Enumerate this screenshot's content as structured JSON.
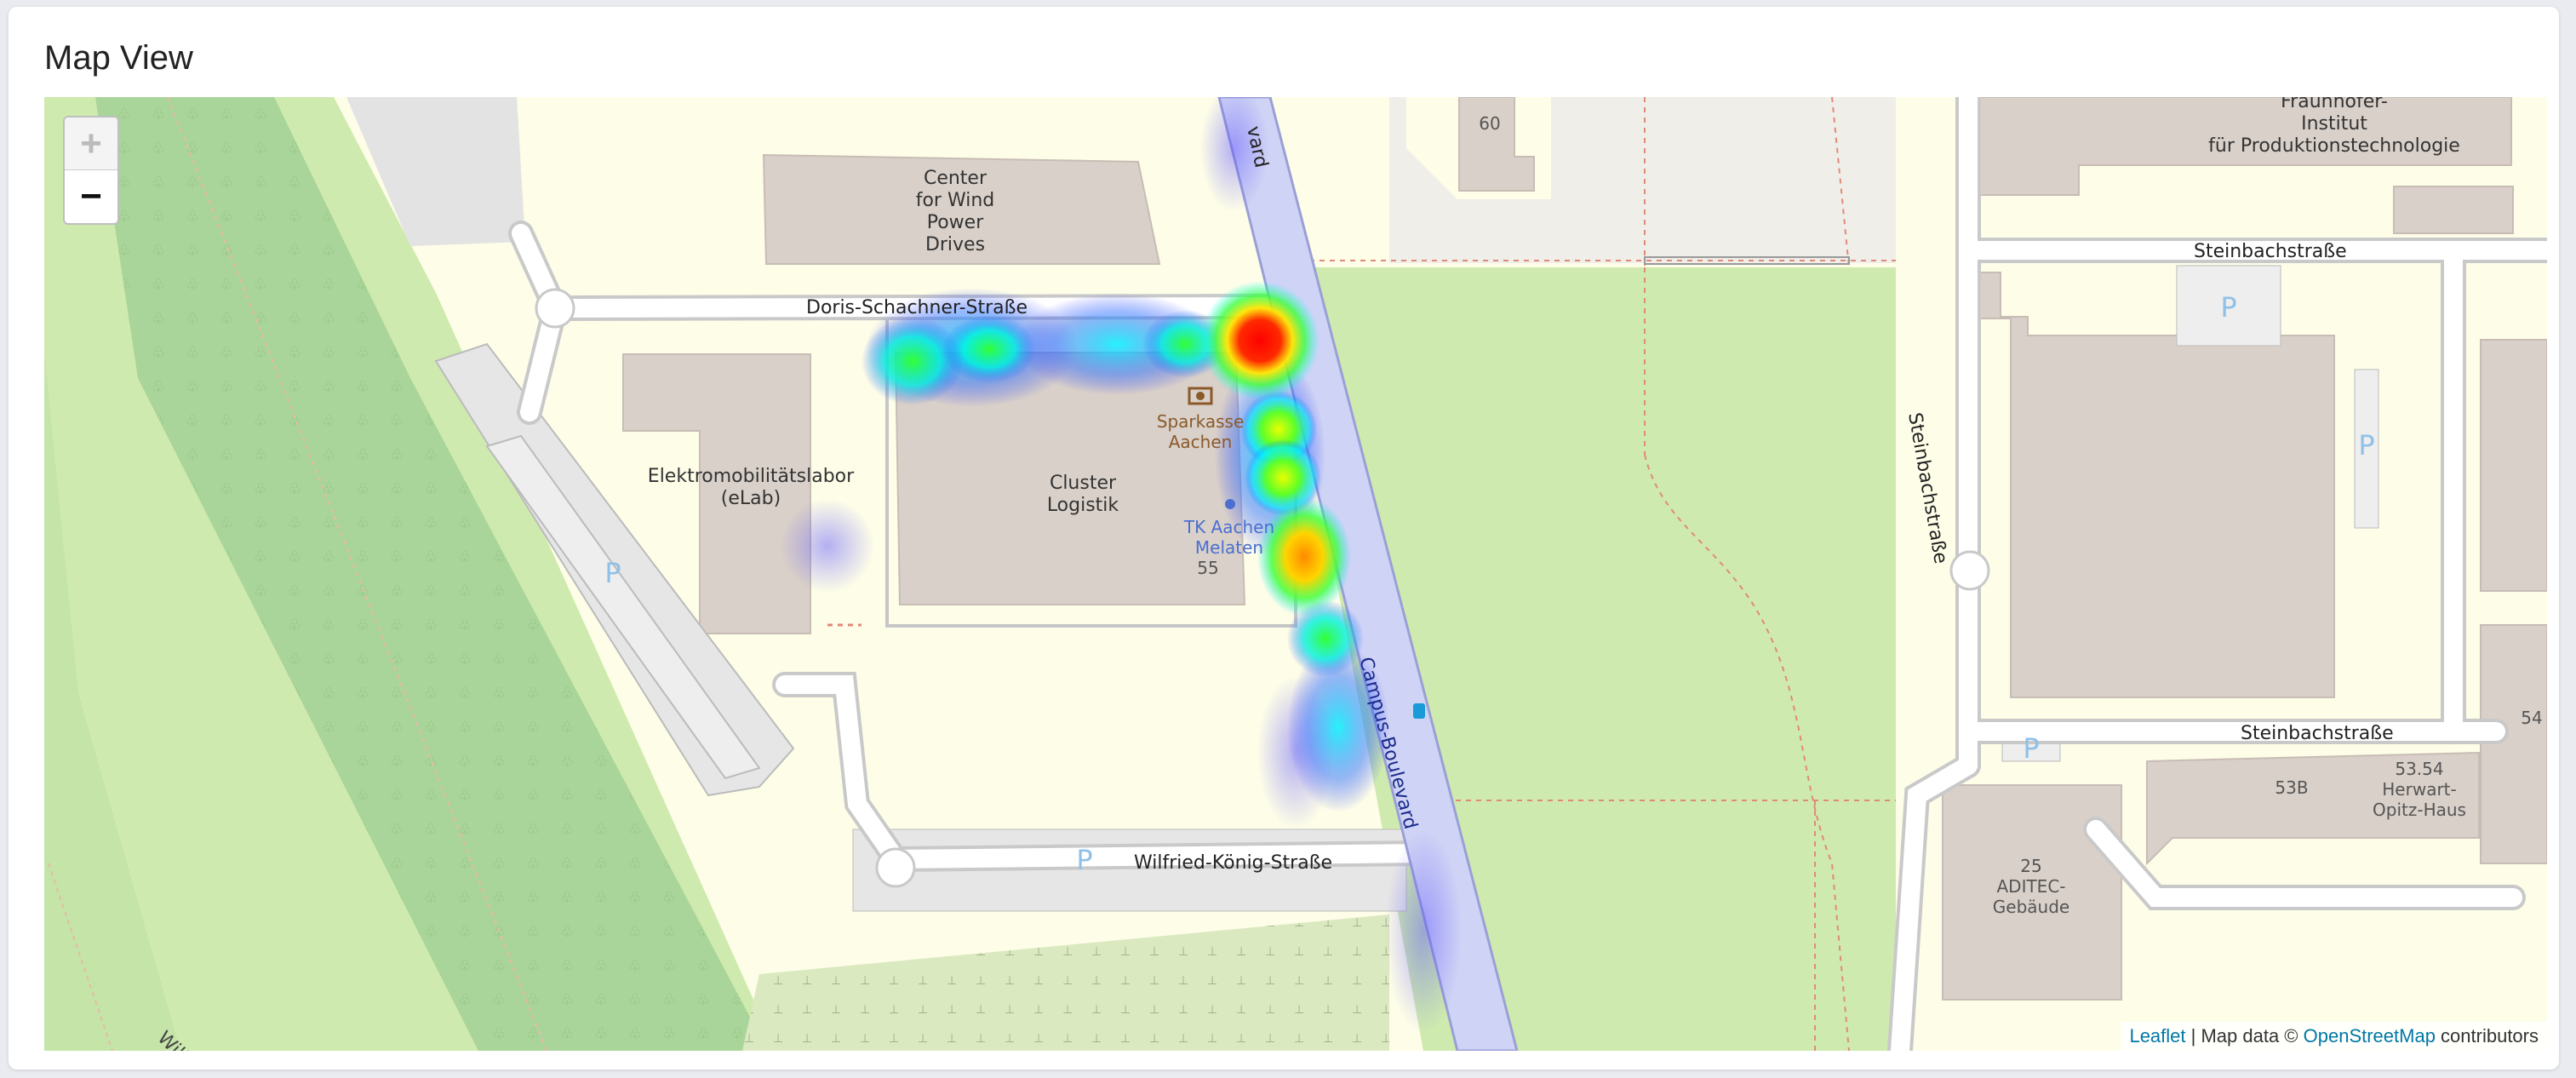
{
  "card": {
    "title": "Map View"
  },
  "zoom": {
    "in_label": "+",
    "out_label": "−"
  },
  "attribution": {
    "leaflet": "Leaflet",
    "separator": " | Map data © ",
    "osm": "OpenStreetMap",
    "suffix": " contributors"
  },
  "map_labels": {
    "campus_boulevard_top": "vard",
    "center_wind": [
      "Center",
      "for Wind",
      "Power",
      "Drives"
    ],
    "doris": "Doris-Schachner-Straße",
    "sparkasse": [
      "Sparkasse",
      "Aachen"
    ],
    "elektro": [
      "Elektromobilitätslabor",
      "(eLab)"
    ],
    "cluster": [
      "Cluster",
      "Logistik"
    ],
    "tk": [
      "TK Aachen",
      "Melaten"
    ],
    "num_55": "55",
    "num_60": "60",
    "campus_boulevard": "Campus-Boulevard",
    "wilfried": "Wilfried-König-Straße",
    "fraunhofer": [
      "Fraunhofer-",
      "Institut",
      "für Produktionstechnologie"
    ],
    "steinbach_top": "Steinbachstraße",
    "steinbach_vertical": "Steinbachstraße",
    "steinbach_bottom": "Steinbachstraße",
    "aditec": [
      "25",
      "ADITEC-",
      "Gebäude"
    ],
    "herwart": [
      "53.54",
      "Herwart-",
      "Opitz-Haus"
    ],
    "num_53b": "53B",
    "num_54": "54",
    "willi": "Willi",
    "parking": "P"
  },
  "heatmap": {
    "points": [
      {
        "lat_rel": 0.255,
        "lng_rel": 0.486,
        "intensity": 1.0
      },
      {
        "lat_rel": 0.5,
        "lng_rel": 0.503,
        "intensity": 0.8
      },
      {
        "lat_rel": 0.345,
        "lng_rel": 0.49,
        "intensity": 0.5
      },
      {
        "lat_rel": 0.4,
        "lng_rel": 0.493,
        "intensity": 0.5
      },
      {
        "lat_rel": 0.565,
        "lng_rel": 0.512,
        "intensity": 0.45
      },
      {
        "lat_rel": 0.28,
        "lng_rel": 0.347,
        "intensity": 0.45
      },
      {
        "lat_rel": 0.265,
        "lng_rel": 0.375,
        "intensity": 0.3
      },
      {
        "lat_rel": 0.635,
        "lng_rel": 0.525,
        "intensity": 0.25
      },
      {
        "lat_rel": 0.47,
        "lng_rel": 0.314,
        "intensity": 0.12
      }
    ]
  }
}
